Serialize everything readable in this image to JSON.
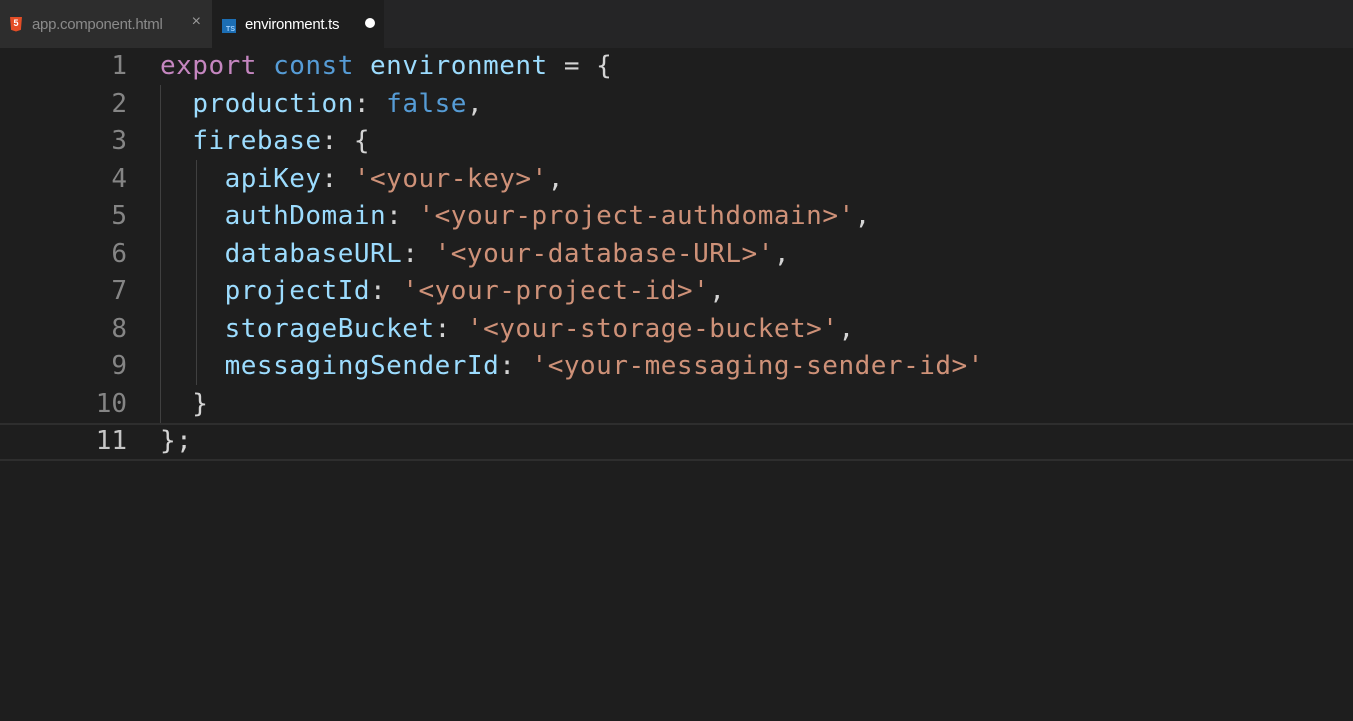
{
  "tabs": [
    {
      "label": "app.component.html",
      "icon": "html5-icon",
      "active": false,
      "close_glyph": "×"
    },
    {
      "label": "environment.ts",
      "icon": "typescript-icon",
      "active": true,
      "dirty": true
    }
  ],
  "icons": {
    "html5_glyph": "5",
    "ts_glyph": "TS"
  },
  "colors": {
    "keyword_control": "#c586c0",
    "keyword": "#569cd6",
    "variable": "#9cdcfe",
    "string": "#ce9178",
    "punctuation": "#d4d4d4",
    "editor_background": "#1e1e1e"
  },
  "editor": {
    "lines": [
      {
        "number": "1",
        "tokens": [
          [
            "kw-ctrl",
            "export"
          ],
          [
            "punc",
            " "
          ],
          [
            "kw",
            "const"
          ],
          [
            "punc",
            " "
          ],
          [
            "var",
            "environment"
          ],
          [
            "punc",
            " = {"
          ]
        ]
      },
      {
        "number": "2",
        "tokens": [
          [
            "punc",
            "  "
          ],
          [
            "var",
            "production"
          ],
          [
            "punc",
            ": "
          ],
          [
            "kw",
            "false"
          ],
          [
            "punc",
            ","
          ]
        ]
      },
      {
        "number": "3",
        "tokens": [
          [
            "punc",
            "  "
          ],
          [
            "var",
            "firebase"
          ],
          [
            "punc",
            ": {"
          ]
        ]
      },
      {
        "number": "4",
        "tokens": [
          [
            "punc",
            "    "
          ],
          [
            "var",
            "apiKey"
          ],
          [
            "punc",
            ": "
          ],
          [
            "str",
            "'<your-key>'"
          ],
          [
            "punc",
            ","
          ]
        ]
      },
      {
        "number": "5",
        "tokens": [
          [
            "punc",
            "    "
          ],
          [
            "var",
            "authDomain"
          ],
          [
            "punc",
            ": "
          ],
          [
            "str",
            "'<your-project-authdomain>'"
          ],
          [
            "punc",
            ","
          ]
        ]
      },
      {
        "number": "6",
        "tokens": [
          [
            "punc",
            "    "
          ],
          [
            "var",
            "databaseURL"
          ],
          [
            "punc",
            ": "
          ],
          [
            "str",
            "'<your-database-URL>'"
          ],
          [
            "punc",
            ","
          ]
        ]
      },
      {
        "number": "7",
        "tokens": [
          [
            "punc",
            "    "
          ],
          [
            "var",
            "projectId"
          ],
          [
            "punc",
            ": "
          ],
          [
            "str",
            "'<your-project-id>'"
          ],
          [
            "punc",
            ","
          ]
        ]
      },
      {
        "number": "8",
        "tokens": [
          [
            "punc",
            "    "
          ],
          [
            "var",
            "storageBucket"
          ],
          [
            "punc",
            ": "
          ],
          [
            "str",
            "'<your-storage-bucket>'"
          ],
          [
            "punc",
            ","
          ]
        ]
      },
      {
        "number": "9",
        "tokens": [
          [
            "punc",
            "    "
          ],
          [
            "var",
            "messagingSenderId"
          ],
          [
            "punc",
            ": "
          ],
          [
            "str",
            "'<your-messaging-sender-id>'"
          ]
        ]
      },
      {
        "number": "10",
        "tokens": [
          [
            "punc",
            "  }"
          ]
        ]
      },
      {
        "number": "11",
        "tokens": [
          [
            "punc",
            "};"
          ]
        ],
        "current": true
      }
    ]
  }
}
